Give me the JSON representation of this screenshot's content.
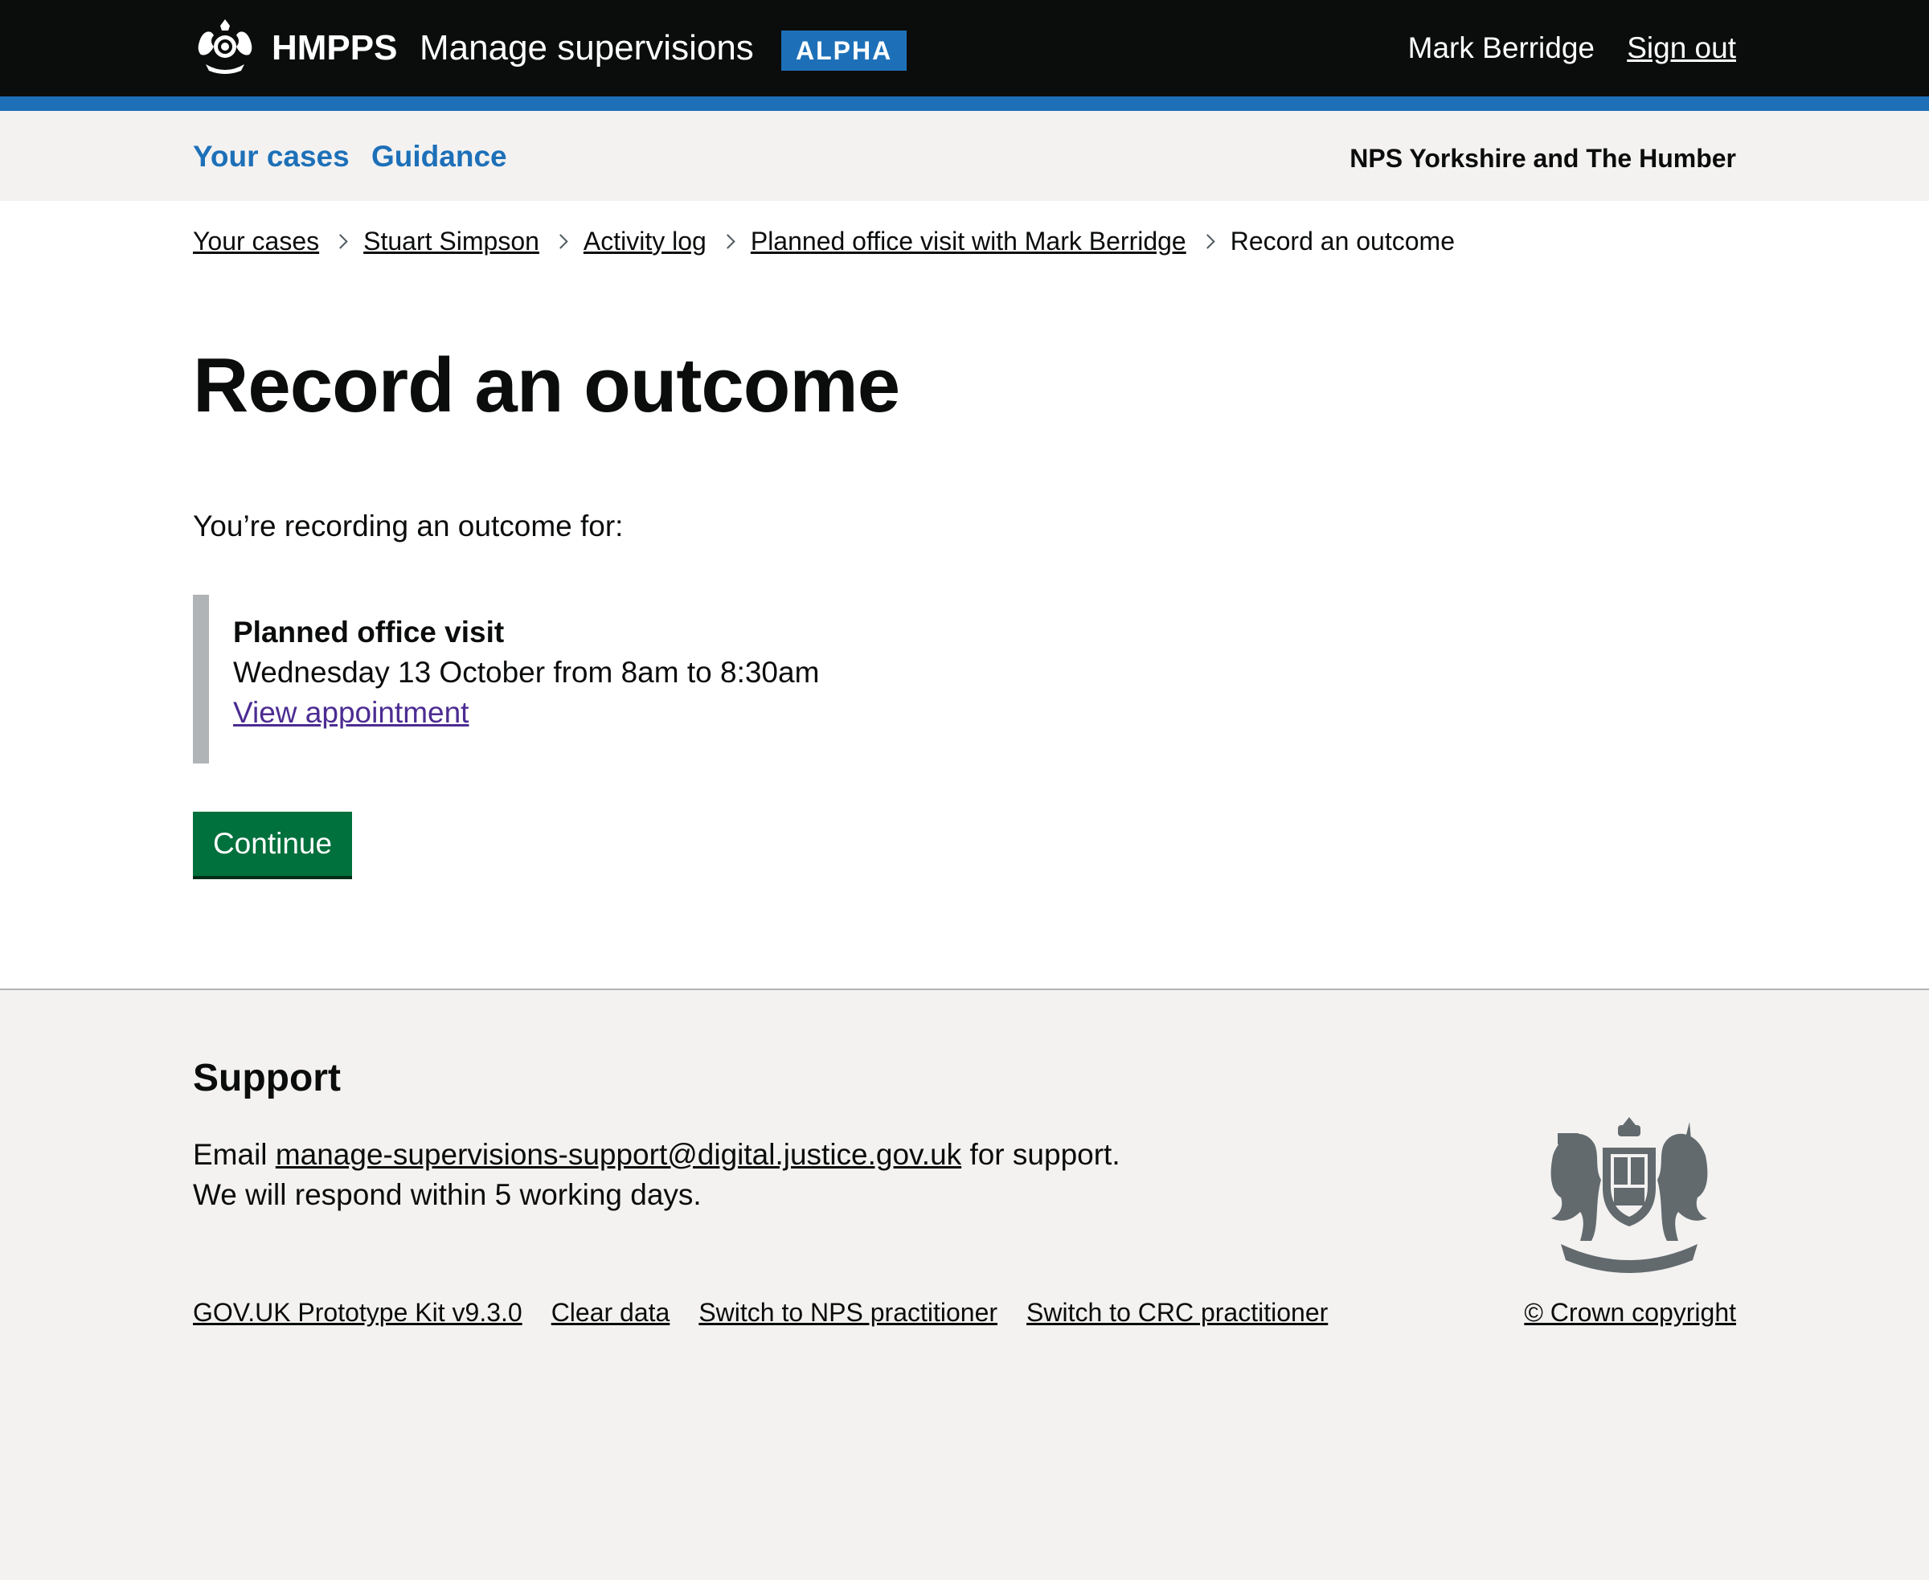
{
  "header": {
    "brand": "HMPPS",
    "service_name": "Manage supervisions",
    "phase_tag": "ALPHA",
    "user_name": "Mark Berridge",
    "sign_out": "Sign out",
    "logo_icon": "royal-crest-icon",
    "accent_color": "#1d70b8"
  },
  "subnav": {
    "items": [
      {
        "label": "Your cases"
      },
      {
        "label": "Guidance"
      }
    ],
    "region": "NPS Yorkshire and The Humber"
  },
  "breadcrumb": {
    "items": [
      {
        "label": "Your cases"
      },
      {
        "label": "Stuart Simpson"
      },
      {
        "label": "Activity log"
      },
      {
        "label": "Planned office visit with Mark Berridge"
      }
    ],
    "current": "Record an outcome"
  },
  "main": {
    "title": "Record an outcome",
    "lead": "You’re recording an outcome for:",
    "appointment": {
      "type": "Planned office visit",
      "time": "Wednesday 13 October from 8am to 8:30am",
      "link": "View appointment"
    },
    "continue_label": "Continue",
    "button_color": "#00703c"
  },
  "footer": {
    "support_title": "Support",
    "support_prefix": "Email",
    "support_email": "manage-supervisions-support@digital.justice.gov.uk",
    "support_suffix": "for support.",
    "support_response": "We will respond within 5 working days.",
    "links": [
      {
        "label": "GOV.UK Prototype Kit v9.3.0"
      },
      {
        "label": "Clear data"
      },
      {
        "label": "Switch to NPS practitioner"
      },
      {
        "label": "Switch to CRC practitioner"
      }
    ],
    "crest_icon": "royal-coat-of-arms-icon",
    "copyright": "© Crown copyright"
  }
}
